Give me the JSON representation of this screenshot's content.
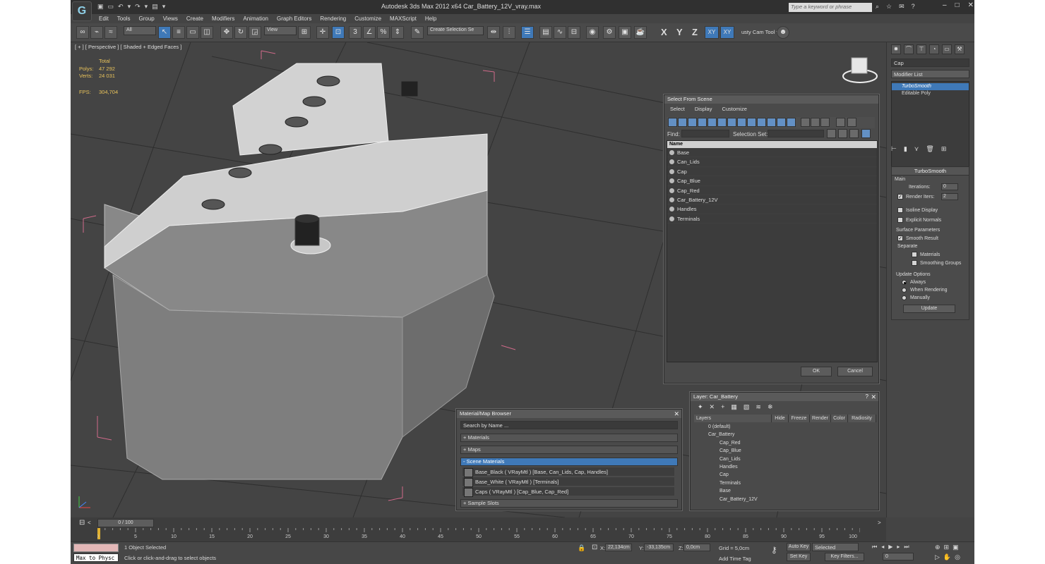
{
  "app": {
    "logo": "G",
    "title": "Autodesk 3ds Max  2012 x64     Car_Battery_12V_vray.max",
    "search_placeholder": "Type a keyword or phrase"
  },
  "quick_access": [
    "▣",
    "▭",
    "↶",
    "▾",
    "↷",
    "▾",
    "▤",
    "▾"
  ],
  "menu": [
    "Edit",
    "Tools",
    "Group",
    "Views",
    "Create",
    "Modifiers",
    "Animation",
    "Graph Editors",
    "Rendering",
    "Customize",
    "MAXScript",
    "Help"
  ],
  "toolbar": {
    "filter": "All",
    "ref_coord": "View",
    "named_selection": "Create Selection Se",
    "axes": [
      "X",
      "Y",
      "Z",
      "XY",
      "XY"
    ],
    "rusty": "usty Cam Tool v"
  },
  "viewport": {
    "label": "[ + ] [ Perspective ] [ Shaded + Edged Faces ]",
    "stats": {
      "total_label": "Total",
      "polys_label": "Polys:",
      "polys": "47 292",
      "verts_label": "Verts:",
      "verts": "24 031",
      "fps_label": "FPS:",
      "fps": "304,704"
    }
  },
  "command_panel": {
    "name_field": "Cap",
    "modifier_list": "Modifier List",
    "stack": [
      "TurboSmooth",
      "Editable Poly"
    ],
    "turbosmooth": {
      "title": "TurboSmooth",
      "main": "Main",
      "iterations_label": "Iterations:",
      "iterations": "0",
      "render_iters_label": "Render Iters:",
      "render_iters": "2",
      "isoline": "Isoline Display",
      "explicit": "Explicit Normals",
      "surface": "Surface Parameters",
      "smooth_result": "Smooth Result",
      "separate": "Separate",
      "materials": "Materials",
      "smoothing_groups": "Smoothing Groups",
      "update_options": "Update Options",
      "always": "Always",
      "when_rendering": "When Rendering",
      "manually": "Manually",
      "update_btn": "Update"
    }
  },
  "select_from_scene": {
    "title": "Select From Scene",
    "menu": [
      "Select",
      "Display",
      "Customize"
    ],
    "find_label": "Find:",
    "selection_set_label": "Selection Set:",
    "column": "Name",
    "items": [
      "Base",
      "Can_Lids",
      "Cap",
      "Cap_Blue",
      "Cap_Red",
      "Car_Battery_12V",
      "Handles",
      "Terminals"
    ],
    "ok": "OK",
    "cancel": "Cancel"
  },
  "material_browser": {
    "title": "Material/Map Browser",
    "search": "Search by Name ...",
    "groups": [
      "+ Materials",
      "+ Maps",
      "- Scene Materials"
    ],
    "items": [
      "Base_Black  ( VRayMtl )  [Base, Can_Lids, Cap, Handles]",
      "Base_White  ( VRayMtl )  [Terminals]",
      "Caps  ( VRayMtl )  [Cap_Blue, Cap_Red]"
    ],
    "sample_slots": "+ Sample Slots"
  },
  "layer": {
    "title": "Layer: Car_Battery",
    "columns": [
      "Layers",
      "Hide",
      "Freeze",
      "Render",
      "Color",
      "Radiosity"
    ],
    "rows": [
      "0 (default)",
      "Car_Battery",
      "Cap_Red",
      "Cap_Blue",
      "Can_Lids",
      "Handles",
      "Cap",
      "Terminals",
      "Base",
      "Car_Battery_12V"
    ]
  },
  "timeline": {
    "frame": "0 / 100",
    "ticks": [
      "0",
      "5",
      "10",
      "15",
      "20",
      "25",
      "30",
      "35",
      "40",
      "45",
      "50",
      "55",
      "60",
      "65",
      "70",
      "75",
      "80",
      "85",
      "90",
      "95",
      "100"
    ]
  },
  "status": {
    "script": "Max to Physc",
    "selected": "1 Object Selected",
    "hint": "Click or click-and-drag to select objects",
    "x_label": "X:",
    "x": "22,134cm",
    "y_label": "Y:",
    "y": "-33,135cm",
    "z_label": "Z:",
    "z": "0,0cm",
    "grid": "Grid = 5,0cm",
    "add_time_tag": "Add Time Tag",
    "auto_key": "Auto Key",
    "set_key": "Set Key",
    "key_mode": "Selected",
    "key_filters": "Key Filters...",
    "frame": "0"
  },
  "colors": {
    "accent": "#3f79b8",
    "bg": "#444444",
    "stats": "#e8c25a"
  }
}
